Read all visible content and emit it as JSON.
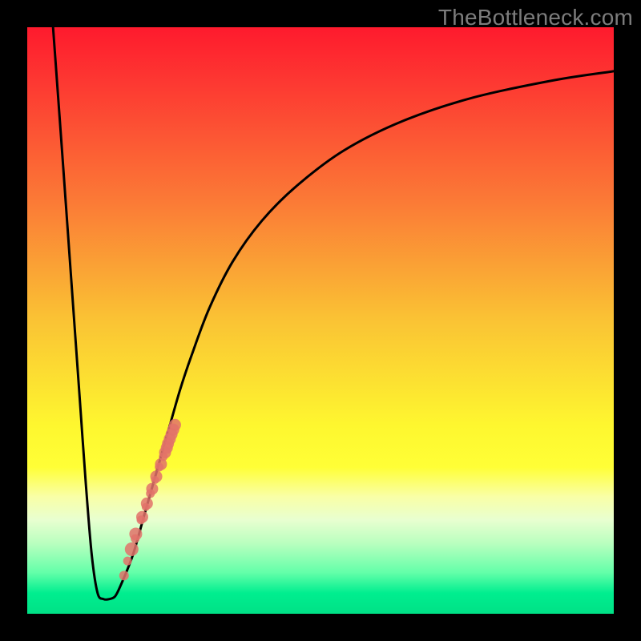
{
  "watermark": "TheBottleneck.com",
  "colors": {
    "frame": "#000000",
    "curve": "#000000",
    "points": "#e2726a",
    "points_opacity": 0.85,
    "gradient_stops": [
      {
        "offset": 0.0,
        "color": "#fe1a2d"
      },
      {
        "offset": 0.1,
        "color": "#fd3a32"
      },
      {
        "offset": 0.3,
        "color": "#fb7b36"
      },
      {
        "offset": 0.5,
        "color": "#fac334"
      },
      {
        "offset": 0.68,
        "color": "#fef72f"
      },
      {
        "offset": 0.75,
        "color": "#ffff36"
      },
      {
        "offset": 0.8,
        "color": "#f9ffa6"
      },
      {
        "offset": 0.84,
        "color": "#e8ffd0"
      },
      {
        "offset": 0.88,
        "color": "#b9ffbf"
      },
      {
        "offset": 0.93,
        "color": "#63ffa9"
      },
      {
        "offset": 0.965,
        "color": "#00ee8f"
      },
      {
        "offset": 1.0,
        "color": "#00e186"
      }
    ]
  },
  "chart_data": {
    "type": "line",
    "title": "",
    "xlabel": "",
    "ylabel": "",
    "xlim": [
      0,
      100
    ],
    "ylim": [
      0,
      100
    ],
    "series": [
      {
        "name": "bottleneck-curve",
        "x": [
          4.4,
          6,
          8,
          9,
          10,
          11,
          12,
          13,
          14,
          15,
          16,
          18,
          20,
          22,
          24,
          26,
          28,
          31,
          35,
          40,
          46,
          54,
          64,
          76,
          90,
          100
        ],
        "y": [
          100,
          78,
          50,
          36,
          22,
          10,
          3.5,
          2.5,
          2.5,
          3,
          5,
          10,
          17,
          24,
          31,
          38,
          44,
          52,
          60,
          67,
          73,
          79,
          84,
          88,
          91,
          92.5
        ]
      }
    ],
    "points": {
      "name": "highlighted-range",
      "x": [
        16.5,
        17.1,
        17.8,
        18.4,
        18.5,
        19.4,
        19.6,
        20.2,
        20.4,
        21.0,
        21.3,
        21.8,
        22.0,
        22.5,
        22.8,
        23.2,
        23.5,
        23.8,
        24.0,
        24.3,
        24.6,
        24.9,
        25.2
      ],
      "y": [
        6.5,
        9.0,
        11.0,
        12.8,
        13.6,
        16.0,
        16.5,
        18.2,
        18.8,
        20.5,
        21.3,
        22.8,
        23.4,
        25.0,
        25.5,
        26.8,
        27.5,
        28.3,
        29.0,
        29.8,
        30.6,
        31.4,
        32.2
      ],
      "r": [
        6,
        5.5,
        8.5,
        5.5,
        8,
        5.5,
        7.5,
        5,
        7.5,
        5.5,
        7.5,
        5,
        7.5,
        5.5,
        7.5,
        5.5,
        7.5,
        7.5,
        7.5,
        7.5,
        7.5,
        7.5,
        7.5
      ]
    }
  }
}
